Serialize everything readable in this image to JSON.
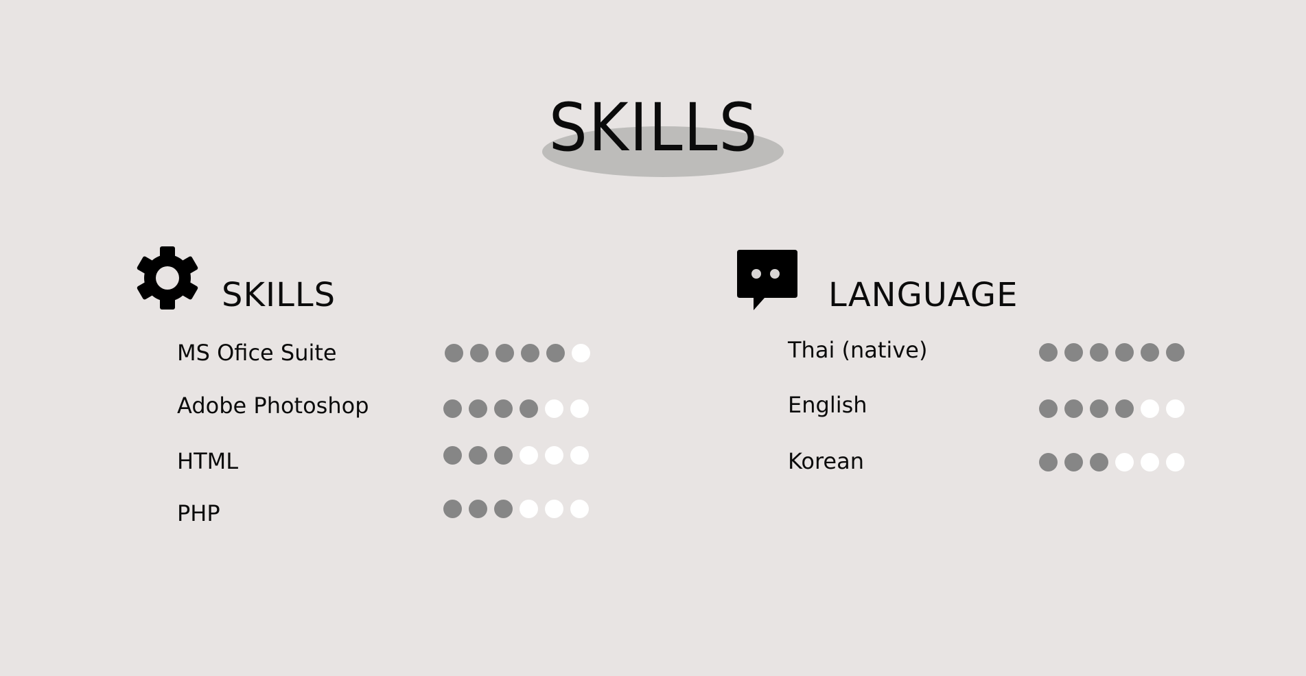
{
  "page": {
    "title": "SKILLS"
  },
  "skills": {
    "title": "SKILLS",
    "icon": "gear-icon",
    "max_level": 6,
    "items": [
      {
        "label": "MS Ofice Suite",
        "level": 5
      },
      {
        "label": "Adobe Photoshop",
        "level": 4
      },
      {
        "label": "HTML",
        "level": 3
      },
      {
        "label": "PHP",
        "level": 3
      }
    ]
  },
  "language": {
    "title": "LANGUAGE",
    "icon": "chat-bubble-icon",
    "max_level": 6,
    "items": [
      {
        "label": "Thai (native)",
        "level": 6
      },
      {
        "label": "English",
        "level": 4
      },
      {
        "label": "Korean",
        "level": 3
      }
    ]
  },
  "colors": {
    "background": "#e8e4e3",
    "dot_filled": "#868686",
    "dot_empty": "#ffffff",
    "title_highlight": "#bdbcba"
  }
}
